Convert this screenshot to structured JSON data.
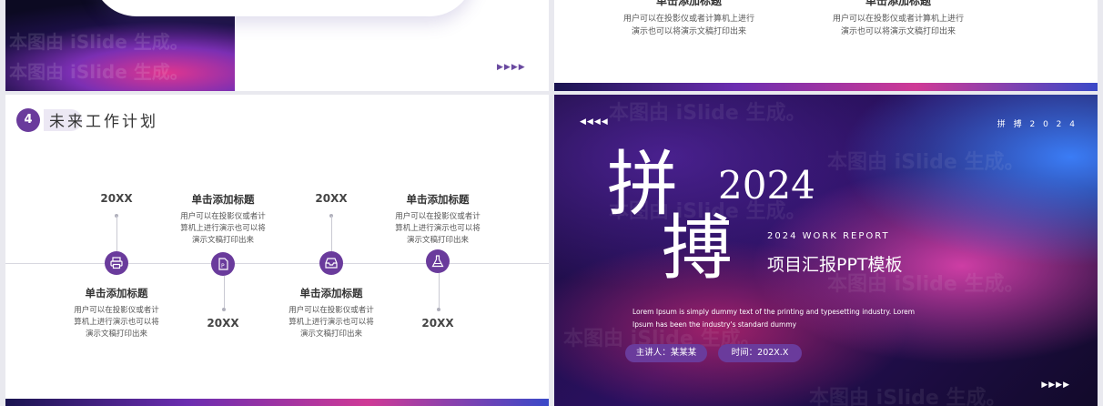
{
  "top_left": {
    "watermark": "本图由 iSlide 生成。"
  },
  "top_right": {
    "features": [
      {
        "title": "单击添加标题",
        "lines": [
          "用户可以在投影仪或者计算机上进行",
          "演示也可以将演示文稿打印出来"
        ]
      },
      {
        "title": "单击添加标题",
        "lines": [
          "用户可以在投影仪或者计算机上进行",
          "演示也可以将演示文稿打印出来"
        ]
      }
    ]
  },
  "plan_slide": {
    "number": "4",
    "title": "未来工作计划",
    "years": [
      "20XX",
      "20XX",
      "20XX",
      "20XX"
    ],
    "items": [
      {
        "title": "单击添加标题",
        "lines": [
          "用户可以在投影仪或者计",
          "算机上进行演示也可以将",
          "演示文稿打印出来"
        ]
      },
      {
        "title": "单击添加标题",
        "lines": [
          "用户可以在投影仪或者计",
          "算机上进行演示也可以将",
          "演示文稿打印出来"
        ]
      },
      {
        "title": "单击添加标题",
        "lines": [
          "用户可以在投影仪或者计",
          "算机上进行演示也可以将",
          "演示文稿打印出来"
        ]
      },
      {
        "title": "单击添加标题",
        "lines": [
          "用户可以在投影仪或者计",
          "算机上进行演示也可以将",
          "演示文稿打印出来"
        ]
      }
    ],
    "icons": [
      "printer-icon",
      "document-icon",
      "inbox-icon",
      "flask-icon"
    ]
  },
  "cover": {
    "tag": "拼 搏 2 0 2 4",
    "big_char_1": "拼",
    "big_char_2": "搏",
    "year": "2024",
    "subtitle_en": "2024 WORK REPORT",
    "subtitle_cn": "项目汇报PPT模板",
    "lorem_1": "Lorem Ipsum is simply dummy text of the printing and typesetting industry. Lorem",
    "lorem_2": "Ipsum has been the industry's standard dummy",
    "presenter": "主讲人：某某某",
    "time": "时间：202X.X",
    "watermark": "本图由 iSlide 生成。"
  },
  "colors": {
    "accent": "#6a3b9c"
  }
}
